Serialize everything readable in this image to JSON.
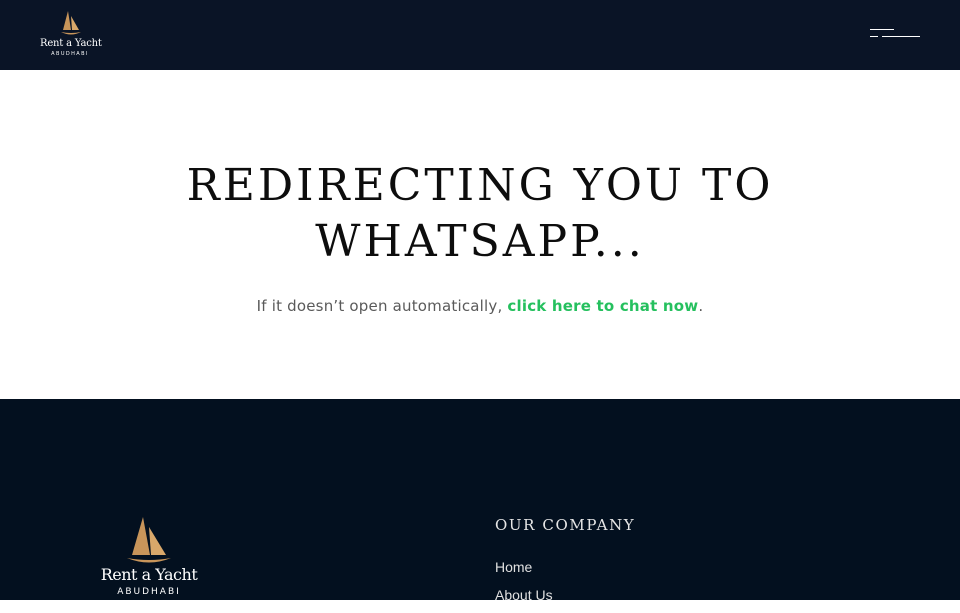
{
  "header": {
    "logo": {
      "brand": "Rent a Yacht",
      "sub": "ABUDHABI"
    },
    "menu_icon": "hamburger-menu-icon"
  },
  "main": {
    "headline_line1": "REDIRECTING YOU TO",
    "headline_line2": "WHATSAPP...",
    "message_prefix": "If it doesn’t open automatically, ",
    "link_text": "click here to chat now",
    "message_suffix": "."
  },
  "footer": {
    "logo": {
      "brand": "Rent a Yacht",
      "sub": "ABUDHABI"
    },
    "company_heading": "OUR COMPANY",
    "links": [
      "Home",
      "About Us"
    ]
  },
  "colors": {
    "header_bg": "#0a1426",
    "footer_bg": "#03101f",
    "link_green": "#25c05e",
    "logo_gold": "#c8955a"
  }
}
